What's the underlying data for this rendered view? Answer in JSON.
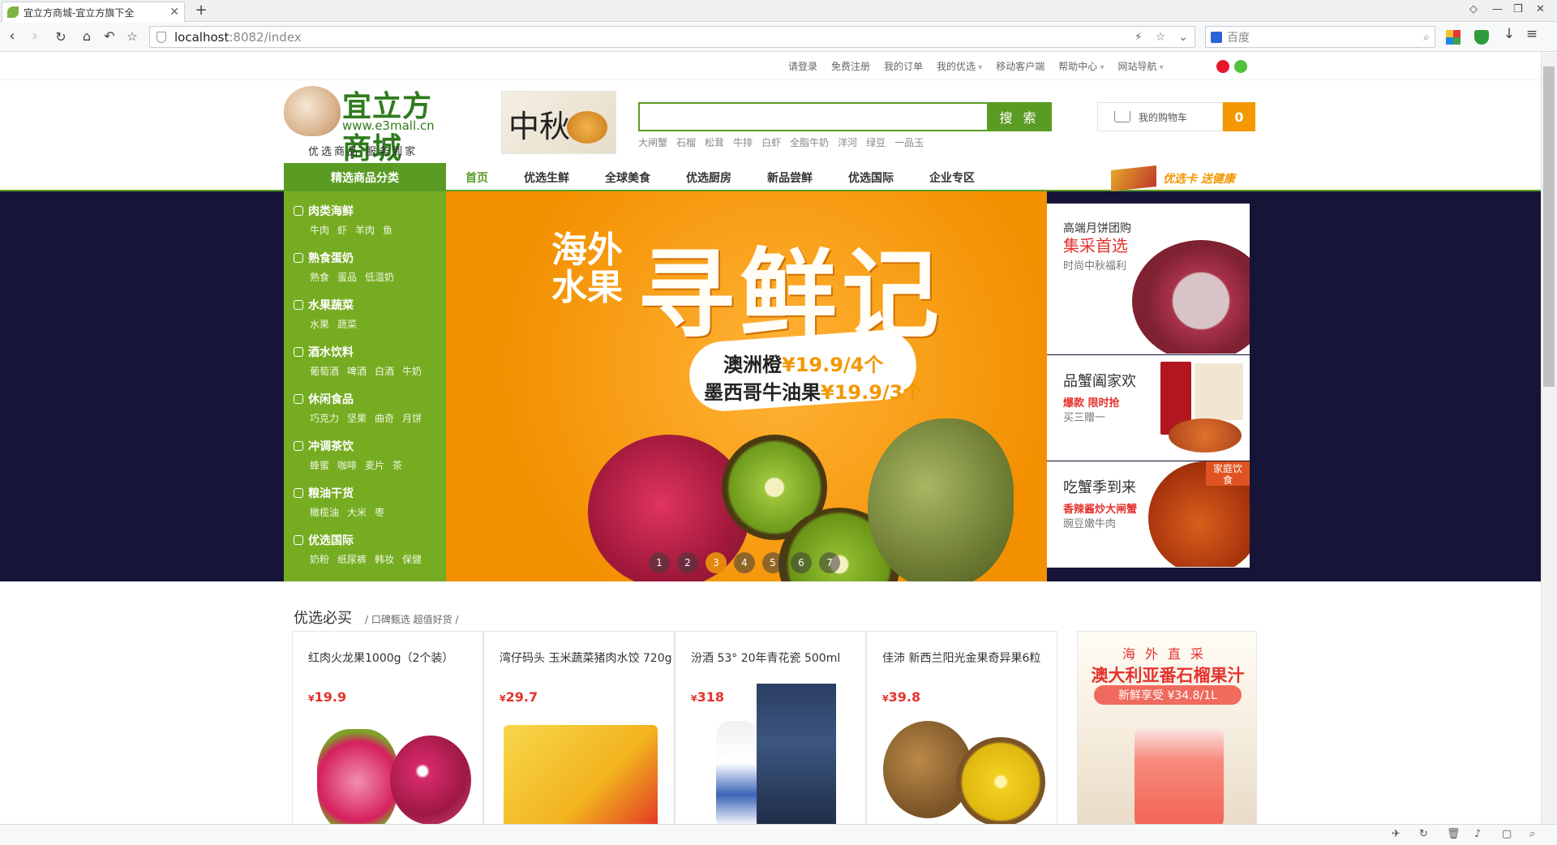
{
  "browser": {
    "tab_title": "宜立方商城-宜立方旗下全",
    "url_host": "localhost",
    "url_rest": ":8082/index",
    "search_engine_placeholder": "百度"
  },
  "topnav": {
    "links": [
      "请登录",
      "免费注册",
      "我的订单",
      "我的优选",
      "移动客户端",
      "帮助中心",
      "网站导航"
    ]
  },
  "header": {
    "logo_name": "宜立方商城",
    "logo_url": "www.e3mall.cn",
    "logo_slogan": "优选商品  服务到家",
    "ad_text": "中秋",
    "search_value": "",
    "search_button": "搜 索",
    "hot_words": [
      "大闸蟹",
      "石榴",
      "松茸",
      "牛排",
      "白虾",
      "全脂牛奶",
      "洋河",
      "绿豆",
      "一品玉"
    ],
    "cart_label": "我的购物车",
    "cart_count": "0"
  },
  "mainnav": {
    "category_label": "精选商品分类",
    "links": [
      "首页",
      "优选生鲜",
      "全球美食",
      "优选厨房",
      "新品尝鲜",
      "优选国际",
      "企业专区"
    ],
    "active": "首页",
    "promo": "优选卡 送健康"
  },
  "categories": [
    {
      "title": "肉类海鲜",
      "icon": "fish-icon",
      "subs": [
        "牛肉",
        "虾",
        "羊肉",
        "鱼"
      ]
    },
    {
      "title": "熟食蛋奶",
      "icon": "bag-icon",
      "subs": [
        "熟食",
        "蛋品",
        "低温奶"
      ]
    },
    {
      "title": "水果蔬菜",
      "icon": "fruit-icon",
      "subs": [
        "水果",
        "蔬菜"
      ]
    },
    {
      "title": "酒水饮料",
      "icon": "bottle-icon",
      "subs": [
        "葡萄酒",
        "啤酒",
        "白酒",
        "牛奶"
      ]
    },
    {
      "title": "休闲食品",
      "icon": "snack-icon",
      "subs": [
        "巧克力",
        "坚果",
        "曲奇",
        "月饼"
      ]
    },
    {
      "title": "冲调茶饮",
      "icon": "tea-icon",
      "subs": [
        "蜂蜜",
        "咖啡",
        "麦片",
        "茶"
      ]
    },
    {
      "title": "粮油干货",
      "icon": "bowl-icon",
      "subs": [
        "橄榄油",
        "大米",
        "枣"
      ]
    },
    {
      "title": "优选国际",
      "icon": "leaf-icon",
      "subs": [
        "奶粉",
        "纸尿裤",
        "韩妆",
        "保健"
      ]
    }
  ],
  "banner": {
    "title_small": "海外\n水果",
    "title_big": "寻鲜记",
    "line1_name": "澳洲橙",
    "line1_price": "¥19.9/4个",
    "line2_name": "墨西哥牛油果",
    "line2_price": "¥19.9/3个",
    "dots": [
      "1",
      "2",
      "3",
      "4",
      "5",
      "6",
      "7"
    ],
    "active_dot": 3
  },
  "right_panels": [
    {
      "h1": "高端月饼团购",
      "h2": "集采首选",
      "h3": "时尚中秋福利"
    },
    {
      "h1": "品蟹阖家欢",
      "h2": "爆款 限时抢",
      "h3": "买三赠一"
    },
    {
      "h1": "吃蟹季到来",
      "h2": "香辣酱炒大闸蟹",
      "h3": "豌豆嫩牛肉",
      "badge": "家庭饮食"
    }
  ],
  "section": {
    "title": "优选必买",
    "subtitle": "/ 口碑甄选  超值好货 /"
  },
  "products": [
    {
      "name": "红肉火龙果1000g（2个装）",
      "price": "19.9"
    },
    {
      "name": "湾仔码头 玉米蔬菜猪肉水饺 720g",
      "price": "29.7"
    },
    {
      "name": "汾酒 53° 20年青花瓷 500ml",
      "price": "318"
    },
    {
      "name": "佳沛  新西兰阳光金果奇异果6粒",
      "price": "39.8"
    }
  ],
  "currency": "¥",
  "right_ad": {
    "line1": "海外直采",
    "line2": "澳大利亚番石榴果汁",
    "line3": "新鲜享受 ¥34.8/1L"
  },
  "colors": {
    "brand_green": "#5a9c23",
    "sidebar_green": "#76ac22",
    "accent_orange": "#f39800",
    "price_red": "#e4332e",
    "hero_bg": "#161538"
  }
}
